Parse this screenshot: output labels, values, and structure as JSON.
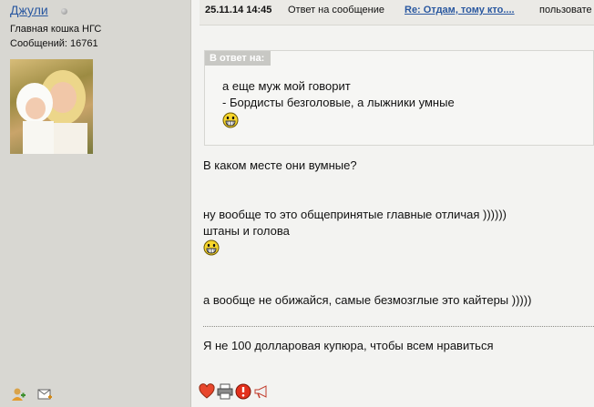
{
  "user": {
    "name": "Джули",
    "rank": "Главная кошка НГС",
    "messages_label": "Сообщений: 16761"
  },
  "post": {
    "date": "25.11.14 14:45",
    "reply_text": "Ответ на сообщение",
    "reply_link": "Re: Отдам, тому кто....",
    "author_tail": "пользовате"
  },
  "quote": {
    "label": "В ответ на:",
    "lines": [
      "а еще муж мой говорит",
      "- Бордисты безголовые, а лыжники умные"
    ]
  },
  "body": {
    "lines": [
      "В каком месте они вумные?",
      "ну вообще то это общепринятые главные отличая ))))))",
      "штаны и голова",
      "а вообще не обижайся, самые безмозглые это кайтеры )))))"
    ],
    "signature": "Я не 100 долларовая купюра, чтобы всем нравиться"
  },
  "icons": {
    "smiley": "grinning-smiley-icon",
    "heart": "heart-icon",
    "print": "print-icon",
    "report": "report-icon",
    "megaphone": "megaphone-icon",
    "add_friend": "add-friend-icon",
    "mail": "private-message-icon"
  },
  "colors": {
    "link": "#2a58a0",
    "sidebar_bg": "#d8d7d2",
    "quote_label_bg": "#c8c8c4"
  }
}
